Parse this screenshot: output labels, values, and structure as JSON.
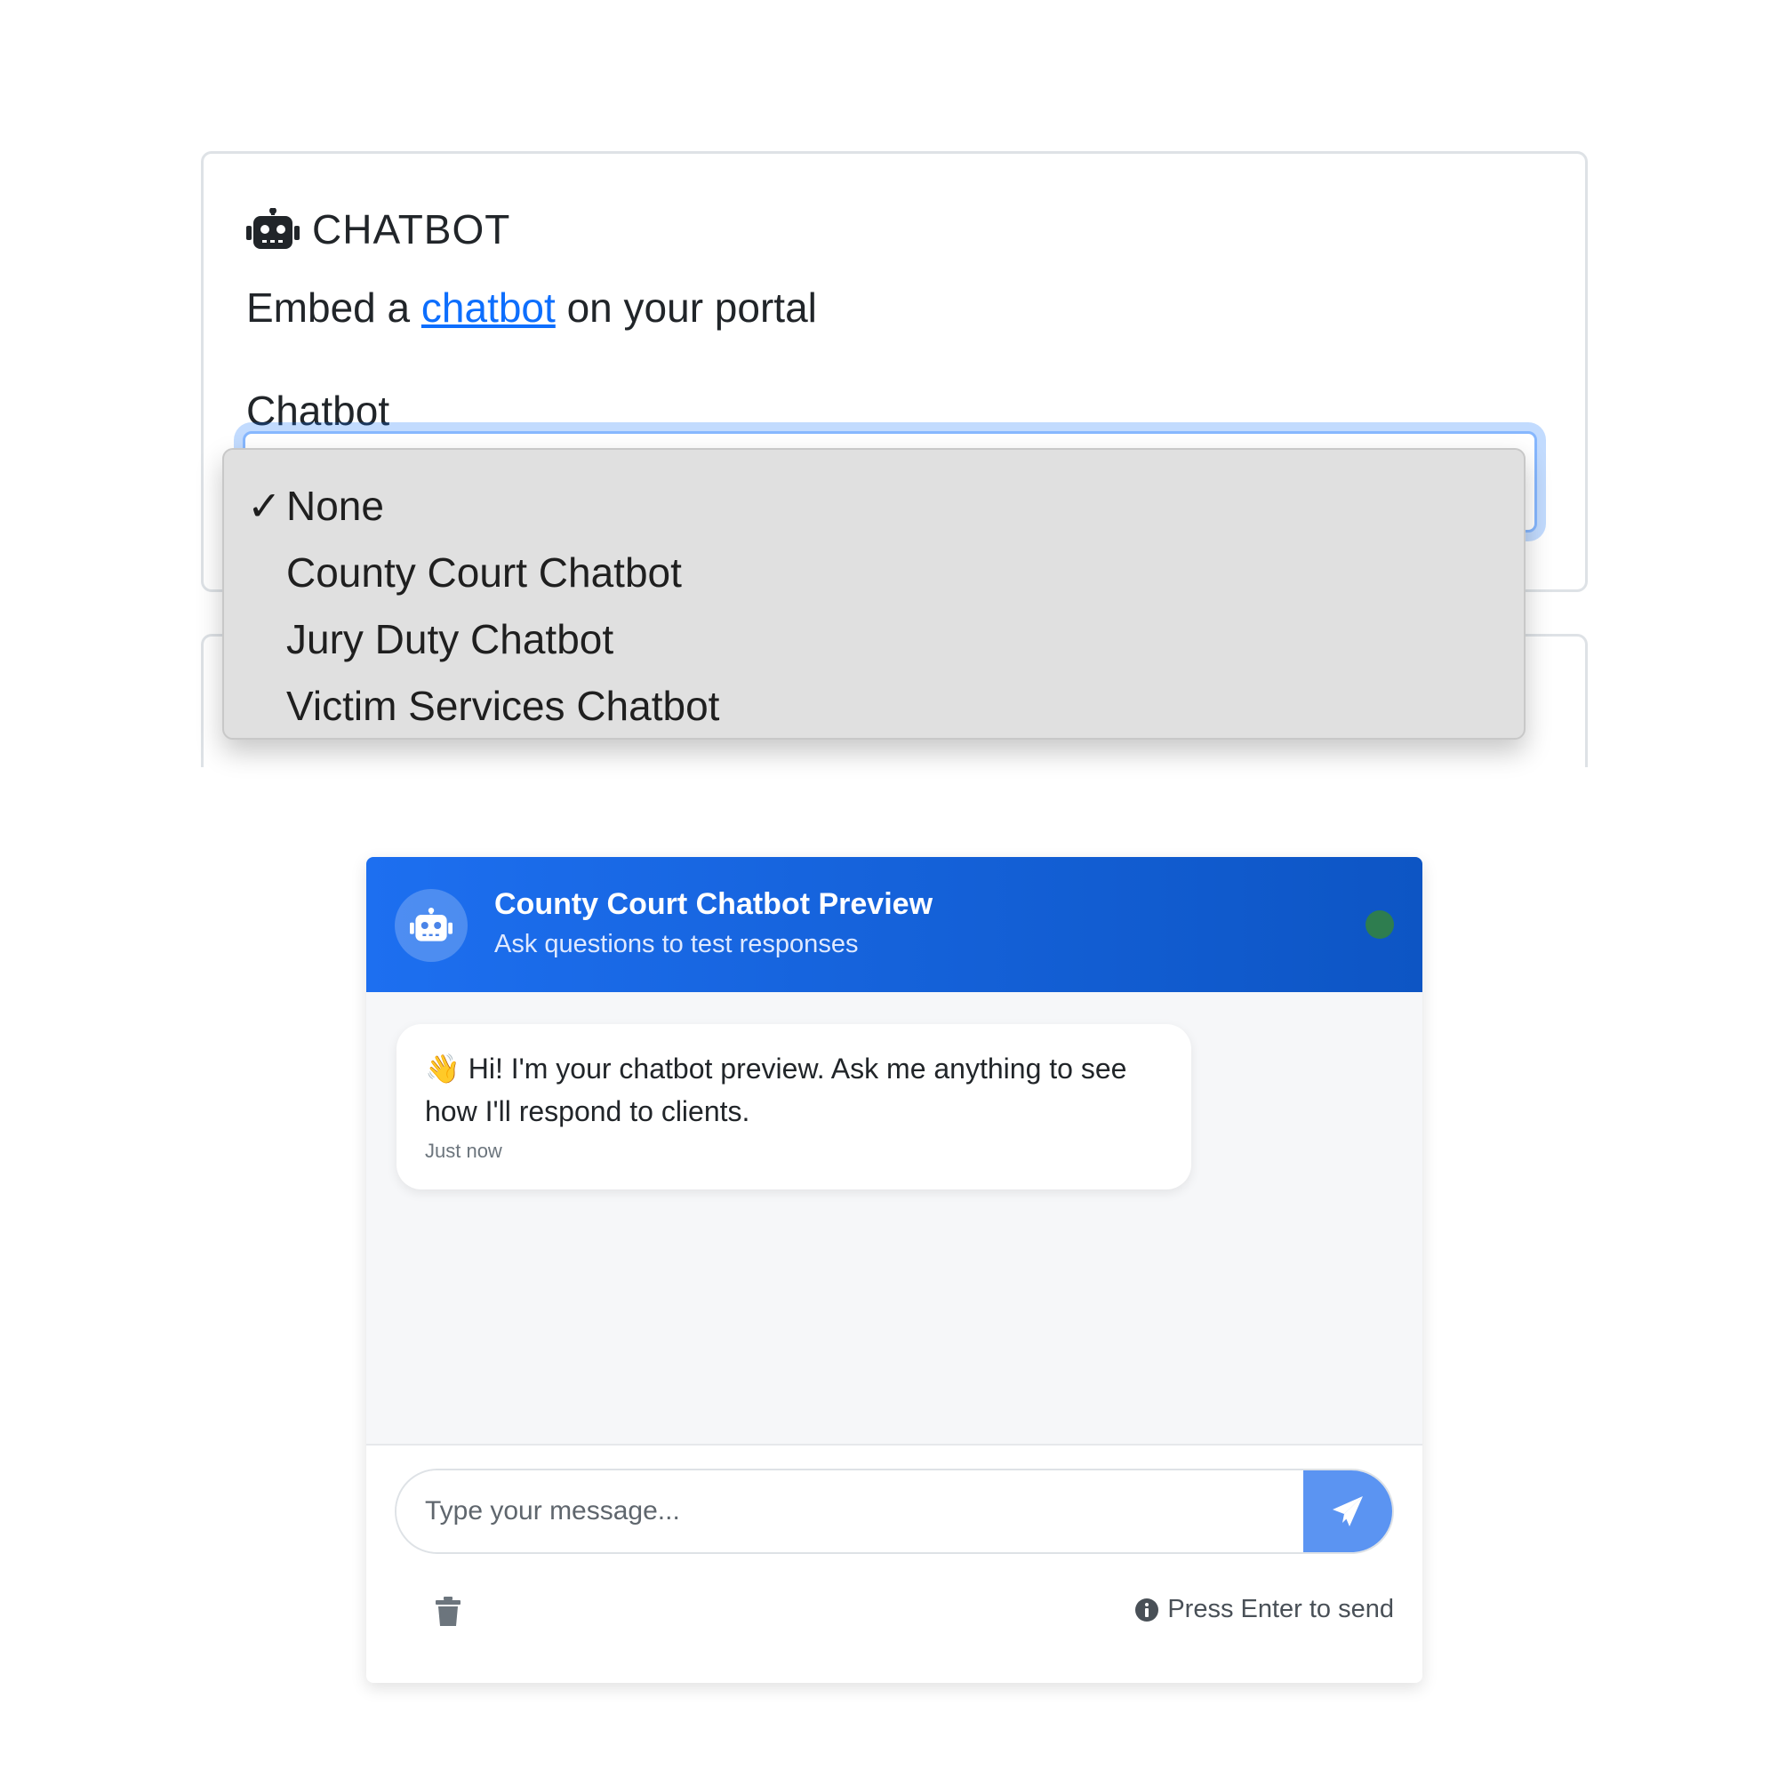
{
  "card": {
    "title": "CHATBOT",
    "desc_prefix": "Embed a ",
    "desc_link": "chatbot",
    "desc_suffix": " on your portal",
    "field_label": "Chatbot"
  },
  "dropdown": {
    "check": "✓",
    "options": [
      "None",
      "County Court Chatbot",
      "Jury Duty Chatbot",
      "Victim Services Chatbot"
    ],
    "selected": "None"
  },
  "chat": {
    "title": "County Court Chatbot Preview",
    "subtitle": "Ask questions to test responses",
    "message_emoji": "👋",
    "message": " Hi! I'm your chatbot preview. Ask me anything to see how I'll respond to clients.",
    "message_time": "Just now",
    "input_placeholder": "Type your message...",
    "hint": "Press Enter to send",
    "icons": [
      "robot-icon",
      "send-icon",
      "trash-icon",
      "info-icon"
    ],
    "colors": {
      "header_start": "#1d6ff0",
      "header_end": "#0d55c4",
      "status": "#2e7d4f",
      "send_button": "#5b94f2",
      "link": "#0d6efd"
    }
  }
}
